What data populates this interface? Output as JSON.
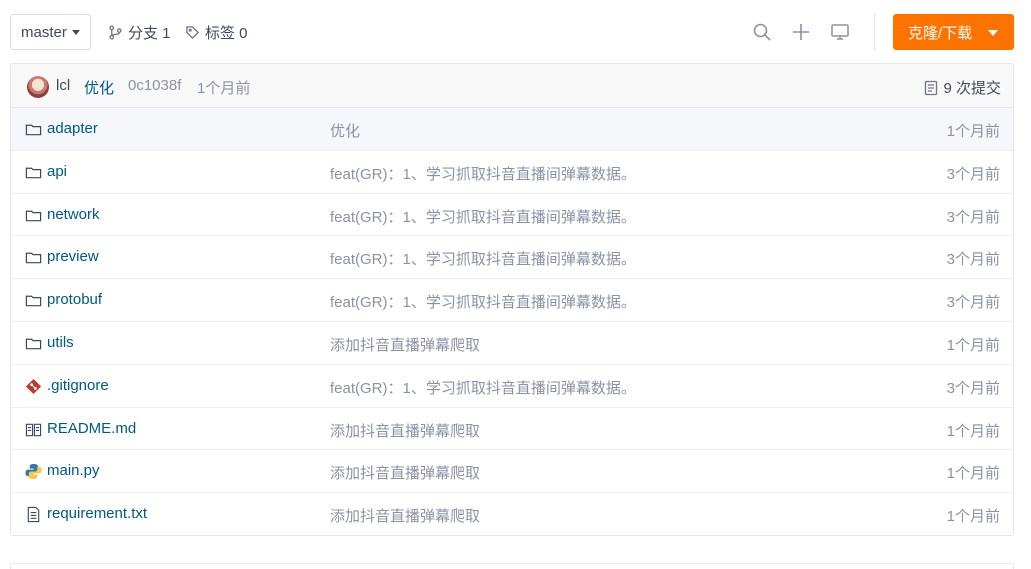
{
  "toolbar": {
    "branch": "master",
    "branches_label": "分支 1",
    "tags_label": "标签 0",
    "clone_label": "克隆/下载"
  },
  "commit": {
    "author": "lcl",
    "message": "优化",
    "sha": "0c1038f",
    "time": "1个月前",
    "count_label": "9 次提交"
  },
  "files": [
    {
      "name": "adapter",
      "type": "folder",
      "message": "优化",
      "time": "1个月前"
    },
    {
      "name": "api",
      "type": "folder",
      "message": "feat(GR)：1、学习抓取抖音直播间弹幕数据。",
      "time": "3个月前"
    },
    {
      "name": "network",
      "type": "folder",
      "message": "feat(GR)：1、学习抓取抖音直播间弹幕数据。",
      "time": "3个月前"
    },
    {
      "name": "preview",
      "type": "folder",
      "message": "feat(GR)：1、学习抓取抖音直播间弹幕数据。",
      "time": "3个月前"
    },
    {
      "name": "protobuf",
      "type": "folder",
      "message": "feat(GR)：1、学习抓取抖音直播间弹幕数据。",
      "time": "3个月前"
    },
    {
      "name": "utils",
      "type": "folder",
      "message": "添加抖音直播弹幕爬取",
      "time": "1个月前"
    },
    {
      "name": ".gitignore",
      "type": "git",
      "message": "feat(GR)：1、学习抓取抖音直播间弹幕数据。",
      "time": "3个月前"
    },
    {
      "name": "README.md",
      "type": "readme",
      "message": "添加抖音直播弹幕爬取",
      "time": "1个月前"
    },
    {
      "name": "main.py",
      "type": "python",
      "message": "添加抖音直播弹幕爬取",
      "time": "1个月前"
    },
    {
      "name": "requirement.txt",
      "type": "text",
      "message": "添加抖音直播弹幕爬取",
      "time": "1个月前"
    }
  ],
  "colors": {
    "accent": "#fe7300",
    "link": "#005980",
    "muted": "#8c92a4"
  }
}
